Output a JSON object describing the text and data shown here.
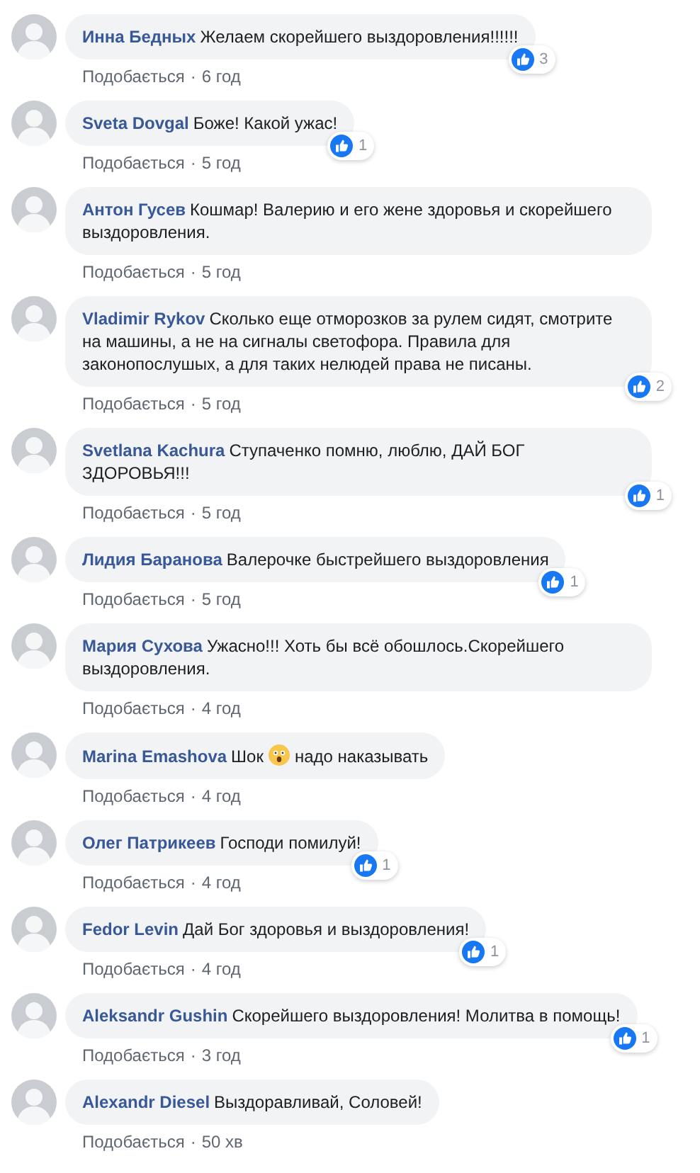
{
  "comments": [
    {
      "author": "Инна Бедных",
      "body": "Желаем скорейшего выздоровления!!!!!!",
      "like_label": "Подобається",
      "separator": "·",
      "time": "6 год",
      "reactions": "3"
    },
    {
      "author": "Sveta Dovgal",
      "body": "Боже! Какой ужас!",
      "like_label": "Подобається",
      "separator": "·",
      "time": "5 год",
      "reactions": "1"
    },
    {
      "author": "Антон Гусев",
      "body": "Кошмар! Валерию и его жене здоровья и скорейшего выздоровления.",
      "like_label": "Подобається",
      "separator": "·",
      "time": "5 год"
    },
    {
      "author": "Vladimir Rykov",
      "body": "Сколько еще отморозков за рулем сидят, смотрите на машины, а не на сигналы светофора. Правила для законопослушых, а для таких нелюдей права не писаны.",
      "like_label": "Подобається",
      "separator": "·",
      "time": "5 год",
      "reactions": "2"
    },
    {
      "author": "Svetlana Kachura",
      "body": "Ступаченко помню, люблю, ДАЙ БОГ ЗДОРОВЬЯ!!!",
      "like_label": "Подобається",
      "separator": "·",
      "time": "5 год",
      "reactions": "1"
    },
    {
      "author": "Лидия Баранова",
      "body": "Валерочке быстрейшего выздоровления",
      "like_label": "Подобається",
      "separator": "·",
      "time": "5 год",
      "reactions": "1"
    },
    {
      "author": "Мария Сухова",
      "body": "Ужасно!!! Хоть бы всё обошлось.Скорейшего выздоровления.",
      "like_label": "Подобається",
      "separator": "·",
      "time": "4 год"
    },
    {
      "author": "Marina Emashova",
      "body": "Шок",
      "emoji": true,
      "body_after": "надо наказывать",
      "like_label": "Подобається",
      "separator": "·",
      "time": "4 год"
    },
    {
      "author": "Олег Патрикеев",
      "body": "Господи помилуй!",
      "like_label": "Подобається",
      "separator": "·",
      "time": "4 год",
      "reactions": "1"
    },
    {
      "author": "Fedor Levin",
      "body": "Дай Бог здоровья и выздоровления!",
      "like_label": "Подобається",
      "separator": "·",
      "time": "4 год",
      "reactions": "1"
    },
    {
      "author": "Aleksandr Gushin",
      "body": "Скорейшего выздоровления! Молитва в помощь!",
      "like_label": "Подобається",
      "separator": "·",
      "time": "3 год",
      "reactions": "1"
    },
    {
      "author": "Alexandr Diesel",
      "body": "Выздоравливай, Соловей!",
      "like_label": "Подобається",
      "separator": "·",
      "time": "50 хв"
    }
  ]
}
